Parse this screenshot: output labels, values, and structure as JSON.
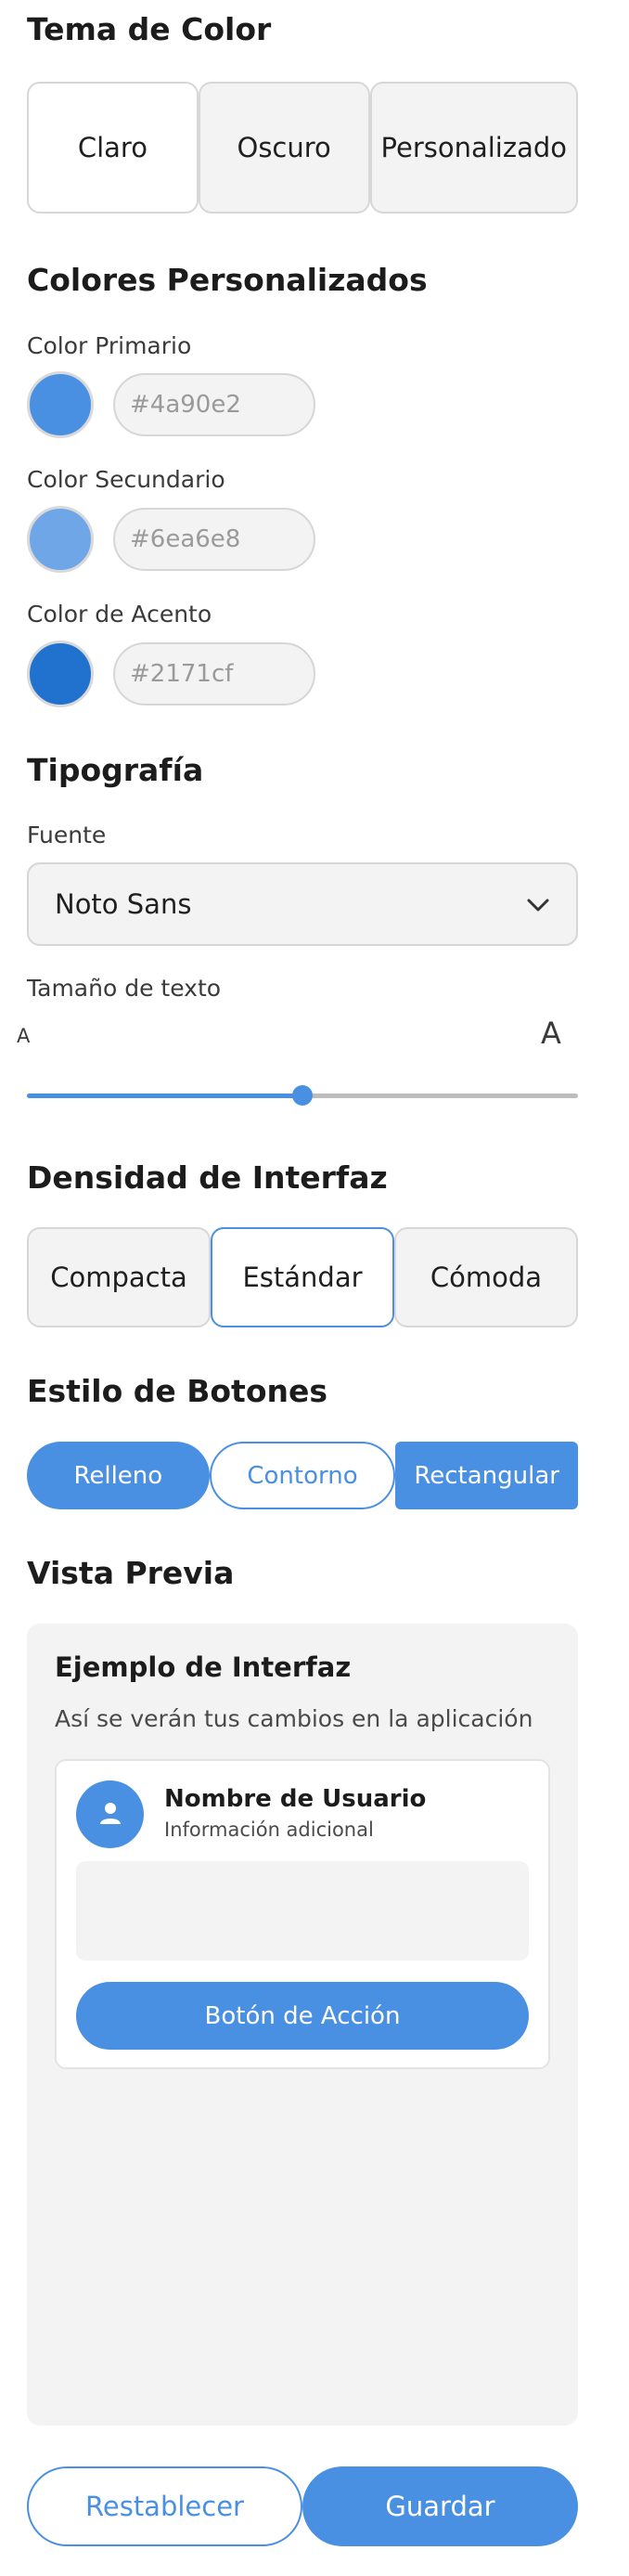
{
  "theme": {
    "title": "Tema de Color",
    "options": [
      "Claro",
      "Oscuro",
      "Personalizado"
    ],
    "selected": "Claro"
  },
  "custom_colors": {
    "title": "Colores Personalizados",
    "primary": {
      "label": "Color Primario",
      "value": "#4a90e2",
      "swatch": "#4a90e2"
    },
    "secondary": {
      "label": "Color Secundario",
      "value": "#6ea6e8",
      "swatch": "#6ea6e8"
    },
    "accent": {
      "label": "Color de Acento",
      "value": "#2171cf",
      "swatch": "#2171cf"
    }
  },
  "typography": {
    "title": "Tipografía",
    "font_label": "Fuente",
    "font_value": "Noto Sans",
    "size_label": "Tamaño de texto",
    "size_min_glyph": "A",
    "size_max_glyph": "A",
    "size_level": 0.5
  },
  "density": {
    "title": "Densidad de Interfaz",
    "options": [
      "Compacta",
      "Estándar",
      "Cómoda"
    ],
    "selected": "Estándar"
  },
  "button_style": {
    "title": "Estilo de Botones",
    "options": [
      "Relleno",
      "Contorno",
      "Rectangular"
    ]
  },
  "preview": {
    "title": "Vista Previa",
    "example_title": "Ejemplo de Interfaz",
    "example_subtitle": "Así se verán tus cambios en la aplicación",
    "user_name": "Nombre de Usuario",
    "user_info": "Información adicional",
    "action_label": "Botón de Acción"
  },
  "footer": {
    "reset_label": "Restablecer",
    "save_label": "Guardar"
  },
  "colors": {
    "accent": "#4a90e2"
  }
}
